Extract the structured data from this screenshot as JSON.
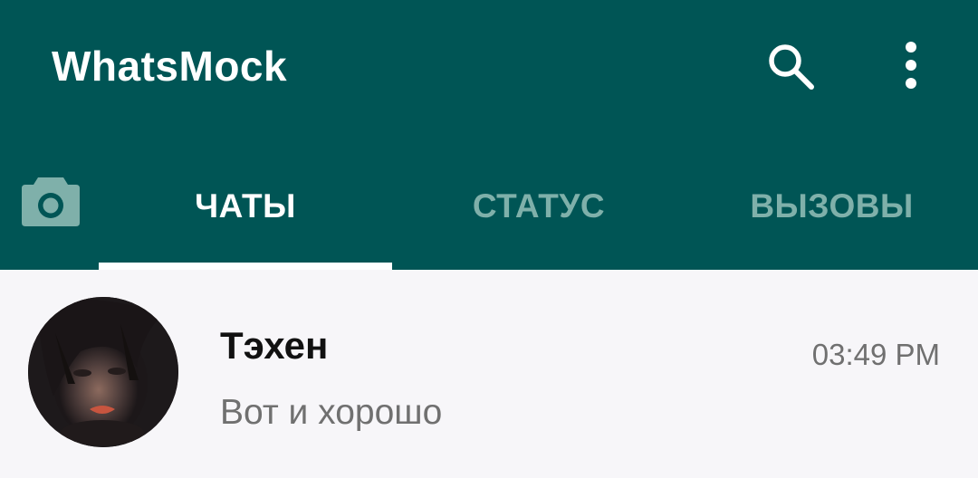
{
  "app": {
    "title": "WhatsMock",
    "colors": {
      "header": "#005555",
      "tab_active": "#ffffff",
      "tab_inactive": "#7fb0aa",
      "background": "#f7f6f9"
    }
  },
  "toolbar": {
    "search_icon": "search-icon",
    "menu_icon": "more-vert-icon"
  },
  "tabs": [
    {
      "icon": "camera-icon"
    },
    {
      "label": "ЧАТЫ",
      "active": true
    },
    {
      "label": "СТАТУС",
      "active": false
    },
    {
      "label": "ВЫЗОВЫ",
      "active": false
    }
  ],
  "chats": [
    {
      "name": "Тэхен",
      "last_message": "Вот и хорошо",
      "time": "03:49 PM",
      "avatar": "contact-avatar"
    }
  ]
}
